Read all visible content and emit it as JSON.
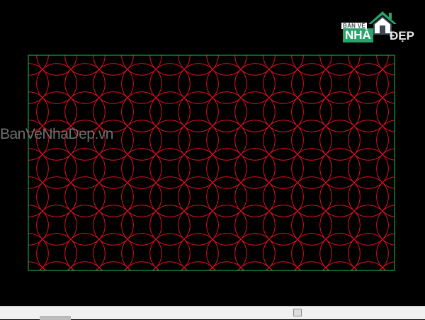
{
  "watermark": {
    "text": "BanVeNhaDep.vn"
  },
  "logo": {
    "small_text": "BẢN VẼ",
    "nha_text": "NHÀ",
    "dep_text": "ĐẸP",
    "colors": {
      "green": "#2aa26b",
      "dark": "#3a4a52"
    }
  },
  "drawing": {
    "pattern": "interlocking-circles",
    "colors": {
      "pattern": "#e01020",
      "border": "#19c34a",
      "background": "#000000"
    }
  },
  "statusbar": {
    "colors": {
      "background": "#f0f0f0"
    }
  }
}
